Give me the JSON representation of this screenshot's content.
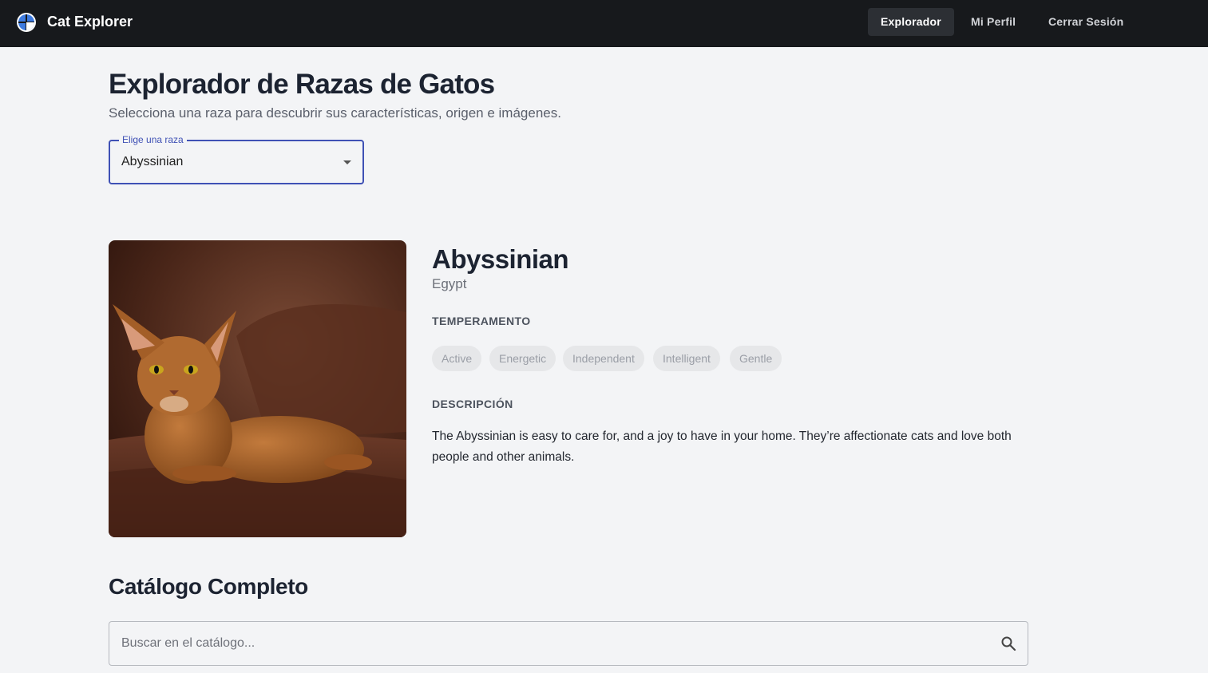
{
  "app": {
    "title": "Cat Explorer",
    "logo_icon": "globe-logo-icon"
  },
  "nav": {
    "items": [
      {
        "label": "Explorador",
        "active": true
      },
      {
        "label": "Mi Perfil",
        "active": false
      },
      {
        "label": "Cerrar Sesión",
        "active": false
      }
    ]
  },
  "header": {
    "title": "Explorador de Razas de Gatos",
    "subtitle": "Selecciona una raza para descubrir sus características, origen e imágenes."
  },
  "breed_select": {
    "label": "Elige una raza",
    "value": "Abyssinian"
  },
  "breed": {
    "name": "Abyssinian",
    "origin": "Egypt",
    "temperament_label": "TEMPERAMENTO",
    "temperament": [
      "Active",
      "Energetic",
      "Independent",
      "Intelligent",
      "Gentle"
    ],
    "description_label": "DESCRIPCIÓN",
    "description": "The Abyssinian is easy to care for, and a joy to have in your home. They’re affectionate cats and love both people and other animals."
  },
  "catalog": {
    "title": "Catálogo Completo",
    "search_placeholder": "Buscar en el catálogo..."
  },
  "colors": {
    "topbar": "#17191c",
    "accent": "#3f51b5",
    "background": "#f3f4f6"
  }
}
